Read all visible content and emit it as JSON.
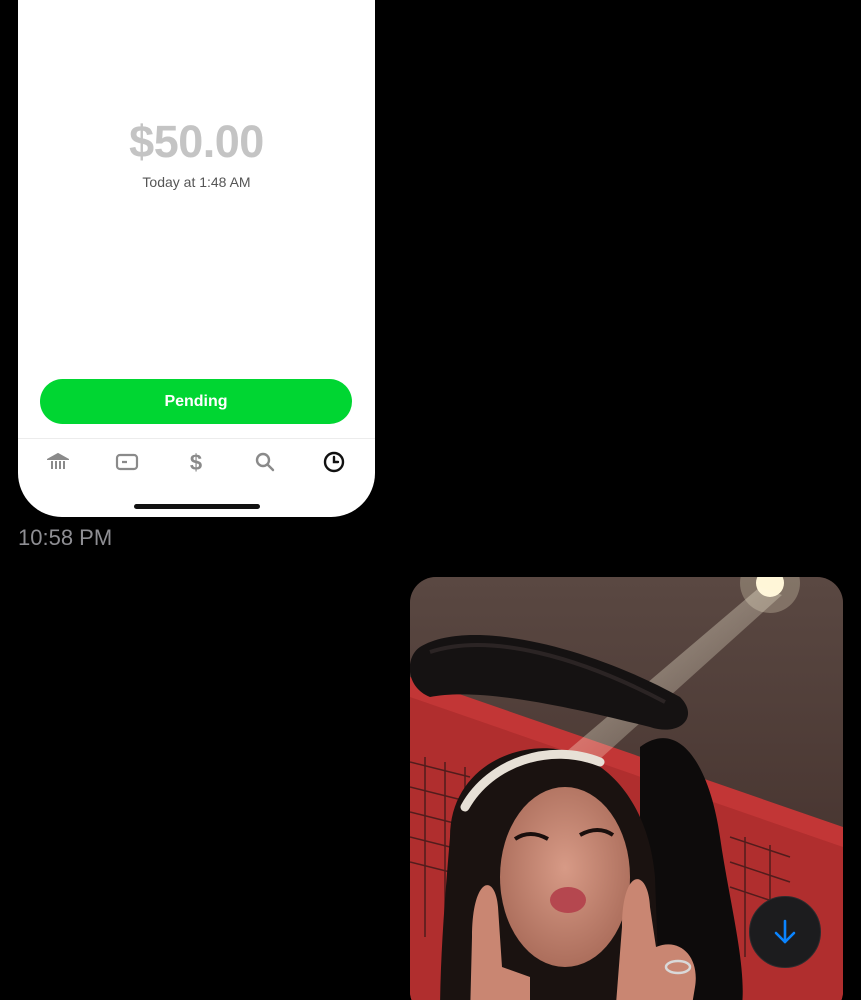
{
  "payment": {
    "amount": "$50.00",
    "datetime": "Today at 1:48 AM",
    "status_button": "Pending"
  },
  "tab_bar": {
    "items": [
      {
        "icon": "bank-icon",
        "active": false
      },
      {
        "icon": "card-icon",
        "active": false
      },
      {
        "icon": "dollar-icon",
        "active": false
      },
      {
        "icon": "search-icon",
        "active": false
      },
      {
        "icon": "clock-icon",
        "active": true
      }
    ]
  },
  "message": {
    "timestamp": "10:58 PM"
  },
  "colors": {
    "accent_green": "#00d632",
    "background": "#000000",
    "scroll_arrow": "#0a84ff"
  },
  "scroll_button": {
    "icon": "arrow-down-icon"
  }
}
